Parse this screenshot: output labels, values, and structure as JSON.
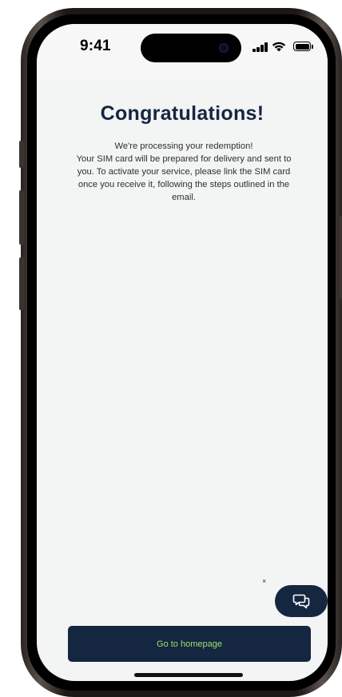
{
  "status_bar": {
    "time": "9:41"
  },
  "header": {
    "title": "Congratulations!"
  },
  "message": {
    "line1": "We're processing your redemption!",
    "line2": "Your SIM card will be prepared for delivery and sent to you. To activate your service, please link the SIM card once you receive it, following the steps outlined in the email."
  },
  "chat": {
    "close_label": "×",
    "icon": "chat-bubbles-icon"
  },
  "actions": {
    "homepage_label": "Go to homepage"
  },
  "colors": {
    "navy": "#152640",
    "accent_green": "#9be36a",
    "background": "#f3f4f4"
  }
}
